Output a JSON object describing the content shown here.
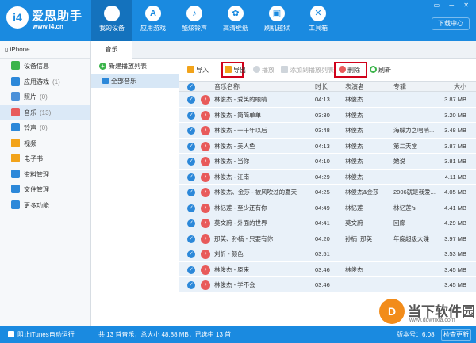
{
  "app": {
    "title": "爱思助手",
    "url": "www.i4.cn"
  },
  "nav": [
    {
      "label": "我的设备",
      "icon": "apple-icon",
      "glyph": "",
      "active": true
    },
    {
      "label": "应用游戏",
      "icon": "app-store-icon",
      "glyph": "A",
      "active": false
    },
    {
      "label": "酷炫铃声",
      "icon": "bell-icon",
      "glyph": "♪",
      "active": false
    },
    {
      "label": "高清壁纸",
      "icon": "flower-icon",
      "glyph": "✿",
      "active": false
    },
    {
      "label": "刷机越狱",
      "icon": "box-icon",
      "glyph": "▣",
      "active": false
    },
    {
      "label": "工具箱",
      "icon": "tools-icon",
      "glyph": "✕",
      "active": false
    }
  ],
  "window": {
    "controls": "▭ ─ ✕",
    "download_center": "下载中心"
  },
  "device": {
    "name": "iPhone"
  },
  "sidebar": [
    {
      "label": "设备信息",
      "count": "",
      "icon": "info-icon",
      "color": "#3bb44a"
    },
    {
      "label": "应用游戏",
      "count": "(1)",
      "icon": "apps-icon",
      "color": "#2c88d9"
    },
    {
      "label": "照片",
      "count": "(0)",
      "icon": "photo-icon",
      "color": "#4a90d9"
    },
    {
      "label": "音乐",
      "count": "(13)",
      "icon": "music-icon",
      "color": "#e85a5a",
      "active": true
    },
    {
      "label": "铃声",
      "count": "(0)",
      "icon": "ringtone-icon",
      "color": "#2c88d9"
    },
    {
      "label": "视频",
      "count": "",
      "icon": "video-icon",
      "color": "#f2a31a"
    },
    {
      "label": "电子书",
      "count": "",
      "icon": "ebook-icon",
      "color": "#f2a31a"
    },
    {
      "label": "资料管理",
      "count": "",
      "icon": "data-icon",
      "color": "#2c88d9"
    },
    {
      "label": "文件管理",
      "count": "",
      "icon": "file-icon",
      "color": "#2c88d9"
    },
    {
      "label": "更多功能",
      "count": "",
      "icon": "more-icon",
      "color": "#2c88d9"
    }
  ],
  "tab": {
    "label": "音乐"
  },
  "playlist": {
    "new_label": "新建播放列表",
    "all_label": "全部音乐"
  },
  "toolbar": {
    "import": "导入",
    "export": "导出",
    "play": "播放",
    "add_to_playlist": "添加到播放列表",
    "delete": "删除",
    "refresh": "刷新"
  },
  "columns": {
    "name": "音乐名称",
    "duration": "时长",
    "artist": "表演者",
    "album": "专辑",
    "size": "大小"
  },
  "songs": [
    {
      "name": "林俊杰 - 爱笑的眼睛",
      "duration": "04:13",
      "artist": "林俊杰",
      "album": "",
      "size": "3.87 MB"
    },
    {
      "name": "林俊杰 - 简简单单",
      "duration": "03:30",
      "artist": "林俊杰",
      "album": "",
      "size": "3.20 MB"
    },
    {
      "name": "林俊杰 - 一千年以后",
      "duration": "03:48",
      "artist": "林俊杰",
      "album": "海蝶力之唱哨...",
      "size": "3.48 MB"
    },
    {
      "name": "林俊杰 - 美人鱼",
      "duration": "04:13",
      "artist": "林俊杰",
      "album": "第二天堂",
      "size": "3.87 MB"
    },
    {
      "name": "林俊杰 - 当你",
      "duration": "04:10",
      "artist": "林俊杰",
      "album": "她说",
      "size": "3.81 MB"
    },
    {
      "name": "林俊杰 - 江南",
      "duration": "04:29",
      "artist": "林俊杰",
      "album": "",
      "size": "4.11 MB"
    },
    {
      "name": "林俊杰、金莎 - 被风吹过的夏天",
      "duration": "04:25",
      "artist": "林俊杰&金莎",
      "album": "2006就是我爱...",
      "size": "4.05 MB"
    },
    {
      "name": "林忆莲 - 至少还有你",
      "duration": "04:49",
      "artist": "林忆莲",
      "album": "林忆莲's",
      "size": "4.41 MB"
    },
    {
      "name": "莫文蔚 - 外面的世界",
      "duration": "04:41",
      "artist": "莫文蔚",
      "album": "回廊",
      "size": "4.29 MB"
    },
    {
      "name": "那英、孙楠 - 只要有你",
      "duration": "04:20",
      "artist": "孙楠_那英",
      "album": "年度超级大碟",
      "size": "3.97 MB"
    },
    {
      "name": "刘忻 - 颜色",
      "duration": "03:51",
      "artist": "",
      "album": "",
      "size": "3.53 MB"
    },
    {
      "name": "林俊杰 - 原来",
      "duration": "03:46",
      "artist": "林俊杰",
      "album": "",
      "size": "3.45 MB"
    },
    {
      "name": "林俊杰 - 学不会",
      "duration": "03:46",
      "artist": "",
      "album": "",
      "size": "3.45 MB"
    }
  ],
  "status": {
    "itunes": "阻止iTunes自动运行",
    "summary": "共 13 首音乐，总大小 48.88 MB，已选中 13 首",
    "version": "版本号：6.08",
    "update": "检查更新"
  },
  "watermark": {
    "title": "当下软件园",
    "url": "www.downxia.com",
    "glyph": "D"
  },
  "colors": {
    "brand_blue": "#1a8ae0",
    "highlight_red": "#d0021b",
    "row_bg": "#e9f1f9",
    "music_red": "#e85a5a"
  }
}
